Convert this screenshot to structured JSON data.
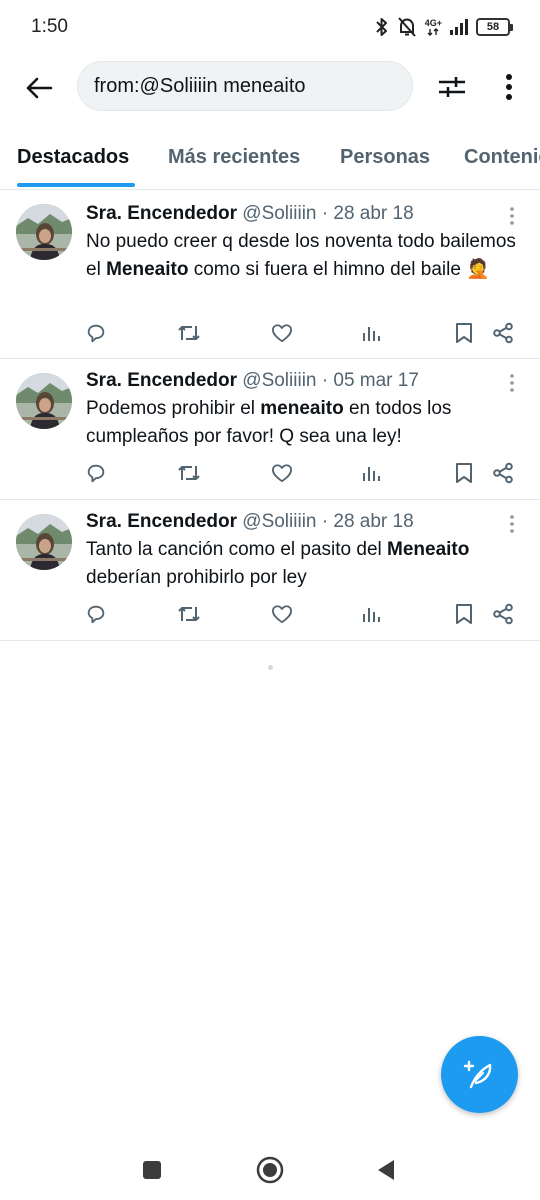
{
  "status_bar": {
    "time": "1:50",
    "network": "4G+",
    "battery": "58",
    "icons": [
      "bluetooth-icon",
      "bell-off-icon",
      "signal-icon",
      "battery-icon"
    ]
  },
  "header": {
    "search_value": "from:@Soliiiin meneaito",
    "icons": [
      "back-arrow-icon",
      "filter-sliders-icon",
      "more-vertical-icon"
    ]
  },
  "tabs": [
    {
      "label": "Destacados",
      "active": true
    },
    {
      "label": "Más recientes",
      "active": false
    },
    {
      "label": "Personas",
      "active": false
    },
    {
      "label": "Contenido",
      "active": false
    }
  ],
  "tweets": [
    {
      "name": "Sra. Encendedor",
      "handle": "@Soliiiin",
      "dot": "·",
      "date": "28 abr 18",
      "text_before": "No puedo creer q desde los noventa todo bailemos el ",
      "highlight": "Meneaito",
      "text_after": " como si fuera el himno del baile 🤦"
    },
    {
      "name": "Sra. Encendedor",
      "handle": "@Soliiiin",
      "dot": "·",
      "date": "05 mar 17",
      "text_before": "Podemos prohibir el ",
      "highlight": "meneaito",
      "text_after": " en todos los cumpleaños por favor! Q sea una ley!"
    },
    {
      "name": "Sra. Encendedor",
      "handle": "@Soliiiin",
      "dot": "·",
      "date": "28 abr 18",
      "text_before": "Tanto la canción como el pasito del ",
      "highlight": "Meneaito",
      "text_after": " deberían prohibirlo por ley"
    }
  ],
  "tweet_actions": [
    "reply-icon",
    "retweet-icon",
    "like-icon",
    "views-icon",
    "bookmark-icon",
    "share-icon"
  ],
  "fab": {
    "icon": "compose-feather-icon"
  },
  "navbar": {
    "icons": [
      "recents-square-icon",
      "home-circle-icon",
      "back-triangle-icon"
    ]
  },
  "colors": {
    "accent": "#1d9bf0",
    "text": "#0f1419",
    "secondary": "#536471",
    "divider": "#e1e8ed"
  }
}
